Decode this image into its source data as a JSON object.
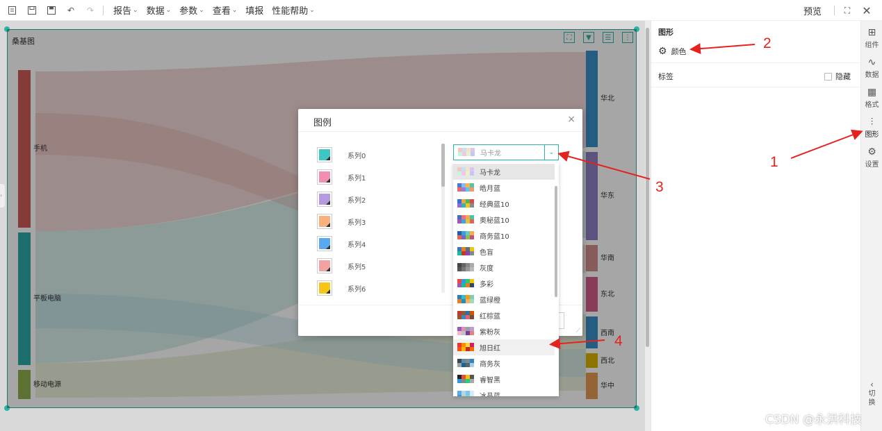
{
  "toolbar": {
    "menus": [
      "报告",
      "数据",
      "参数",
      "查看",
      "填报",
      "性能帮助"
    ],
    "preview": "预览"
  },
  "chart": {
    "title": "桑基图",
    "nodes_left": [
      "手机",
      "平板电脑",
      "移动电源"
    ],
    "nodes_right": [
      "华北",
      "华东",
      "华南",
      "东北",
      "西南",
      "西北",
      "华中"
    ]
  },
  "right_panel": {
    "title": "图形",
    "color_label": "颜色",
    "tag_label": "标签",
    "hide_label": "隐藏"
  },
  "side_tabs": [
    "组件",
    "数据",
    "格式",
    "图形",
    "设置"
  ],
  "switch_label": [
    "切",
    "换"
  ],
  "dialog": {
    "title": "图例",
    "close": "×",
    "series": [
      {
        "label": "系列0",
        "color": "#3fc6c3"
      },
      {
        "label": "系列1",
        "color": "#f08fb3"
      },
      {
        "label": "系列2",
        "color": "#b49be0"
      },
      {
        "label": "系列3",
        "color": "#f7b07e"
      },
      {
        "label": "系列4",
        "color": "#5aa8ef"
      },
      {
        "label": "系列5",
        "color": "#f0a3a0"
      },
      {
        "label": "系列6",
        "color": "#f5c518"
      }
    ],
    "palette_selected": "马卡龙",
    "palettes": [
      "马卡龙",
      "皓月蓝",
      "经典蓝10",
      "奥秘蓝10",
      "商务蓝10",
      "色盲",
      "灰度",
      "多彩",
      "蓝绿橙",
      "红棕蓝",
      "紫粉灰",
      "旭日红",
      "商务灰",
      "睿智黑",
      "冰晶蓝"
    ]
  },
  "annotations": [
    "1",
    "2",
    "3",
    "4"
  ],
  "watermark": "CSDN @永洪科技"
}
